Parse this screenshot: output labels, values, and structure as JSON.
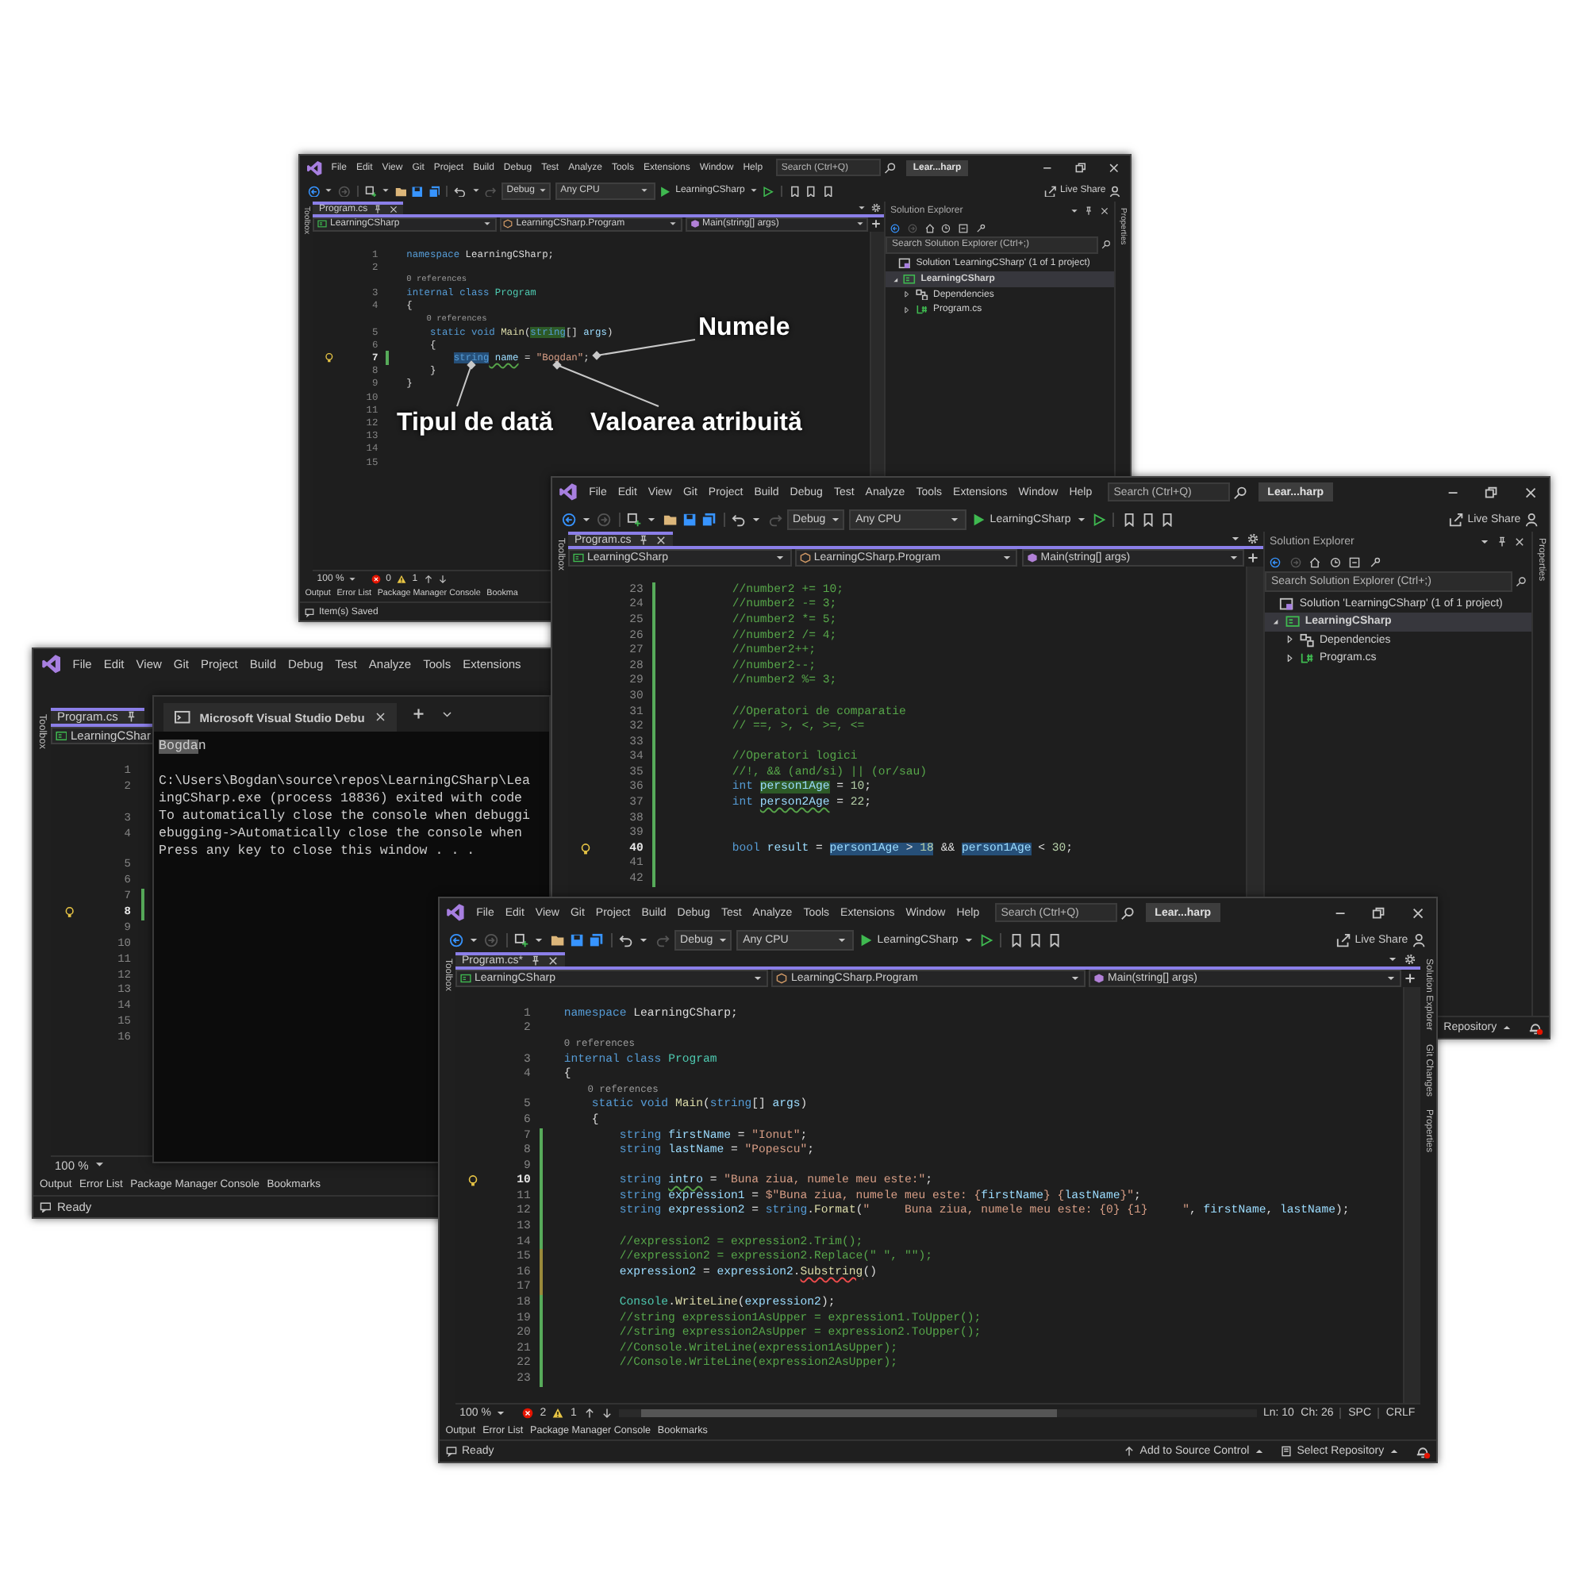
{
  "windows": [
    {
      "kind": "vs",
      "menu": [
        "File",
        "Edit",
        "View",
        "Git",
        "Project",
        "Build",
        "Debug",
        "Test",
        "Analyze",
        "Tools",
        "Extensions",
        "Window",
        "Help"
      ],
      "search": {
        "placeholder": "Search (Ctrl+Q)"
      },
      "title": "Lear...harp",
      "toolbar": {
        "configuration": "Debug",
        "platform": "Any CPU",
        "startup": "LearningCSharp",
        "live_share": "Live Share"
      },
      "left_strip": "Toolbox",
      "right_strip": [
        "Properties"
      ],
      "tab": {
        "label": "Program.cs"
      },
      "nav": [
        "LearningCSharp",
        "LearningCSharp.Program",
        "Main(string[] args)"
      ],
      "editor": {
        "lines": [
          {
            "kind": "code",
            "n": "1",
            "tokens": [
              {
                "t": "namespace",
                "kind": "keyword"
              },
              {
                "t": " LearningCSharp;",
                "kind": "plain"
              }
            ]
          },
          {
            "kind": "code",
            "n": "2"
          },
          {
            "kind": "lens",
            "text": "0 references"
          },
          {
            "kind": "code",
            "n": "3",
            "tokens": [
              {
                "t": "internal class ",
                "kind": "keyword"
              },
              {
                "t": "Program",
                "kind": "type"
              }
            ]
          },
          {
            "kind": "code",
            "n": "4",
            "tokens": [
              {
                "t": "{",
                "kind": "plain"
              }
            ]
          },
          {
            "kind": "lens",
            "text": "    0 references"
          },
          {
            "kind": "code",
            "n": "5",
            "tokens": [
              {
                "t": "    static void ",
                "kind": "keyword"
              },
              {
                "t": "Main",
                "kind": "method"
              },
              {
                "t": "(",
                "kind": "plain"
              },
              {
                "t": "string",
                "kind": "keyword",
                "highlighted": true
              },
              {
                "t": "[] ",
                "kind": "plain"
              },
              {
                "t": "args",
                "kind": "variable"
              },
              {
                "t": ")",
                "kind": "plain"
              }
            ]
          },
          {
            "kind": "code",
            "n": "6",
            "tokens": [
              {
                "t": "    {",
                "kind": "plain"
              }
            ]
          },
          {
            "kind": "code",
            "n": "7",
            "current": true,
            "color": "#57ab5a",
            "tokens": [
              {
                "t": "        string",
                "kind": "keyword",
                "selected": true
              },
              {
                "t": " name",
                "kind": "variable",
                "warning": true
              },
              {
                "t": " = ",
                "kind": "plain"
              },
              {
                "t": "\"Bogdan\"",
                "kind": "string"
              },
              {
                "t": ";",
                "kind": "plain"
              }
            ]
          },
          {
            "kind": "code",
            "n": "8",
            "tokens": [
              {
                "t": "    }",
                "kind": "plain"
              }
            ]
          },
          {
            "kind": "code",
            "n": "9",
            "tokens": [
              {
                "t": "}",
                "kind": "plain"
              }
            ]
          },
          {
            "kind": "code",
            "n": "10"
          },
          {
            "kind": "code",
            "n": "11"
          },
          {
            "kind": "code",
            "n": "12"
          },
          {
            "kind": "code",
            "n": "13"
          },
          {
            "kind": "code",
            "n": "14"
          },
          {
            "kind": "code",
            "n": "15"
          }
        ]
      },
      "editor_status": {
        "zoom": "100 %",
        "errors": "0",
        "warnings": "1"
      },
      "solution_explorer": {
        "title": "Solution Explorer",
        "search": {
          "placeholder": "Search Solution Explorer (Ctrl+;)"
        },
        "solution": "Solution 'LearningCSharp' (1 of 1 project)",
        "items": [
          {
            "label": "LearningCSharp",
            "kind": "project",
            "expanded": true,
            "selected": true,
            "children": [
              {
                "label": "Dependencies",
                "kind": "deps",
                "expanded": false,
                "selected": false
              },
              {
                "label": "Program.cs",
                "kind": "file",
                "expanded": false,
                "selected": false
              }
            ]
          }
        ]
      },
      "bottom_tabs": [
        "Output",
        "Error List",
        "Package Manager Console",
        "Bookma"
      ],
      "status": {
        "text": "Item(s) Saved"
      }
    },
    {
      "kind": "vs",
      "menu": [
        "File",
        "Edit",
        "View",
        "Git",
        "Project",
        "Build",
        "Debug",
        "Test",
        "Analyze",
        "Tools",
        "Extensions"
      ],
      "left_strip": "Toolbox",
      "tab": {
        "label": "Program.cs"
      },
      "nav": [
        "LearningCShar"
      ],
      "editor": {
        "lines": [
          {
            "kind": "code",
            "n": "1"
          },
          {
            "kind": "code",
            "n": "2"
          },
          {
            "kind": "lens"
          },
          {
            "kind": "code",
            "n": "3"
          },
          {
            "kind": "code",
            "n": "4"
          },
          {
            "kind": "lens"
          },
          {
            "kind": "code",
            "n": "5"
          },
          {
            "kind": "code",
            "n": "6"
          },
          {
            "kind": "code",
            "n": "7",
            "color": "#57ab5a"
          },
          {
            "kind": "code",
            "n": "8",
            "current": true,
            "color": "#57ab5a"
          },
          {
            "kind": "code",
            "n": "9"
          },
          {
            "kind": "code",
            "n": "10"
          },
          {
            "kind": "code",
            "n": "11"
          },
          {
            "kind": "code",
            "n": "12"
          },
          {
            "kind": "code",
            "n": "13"
          },
          {
            "kind": "code",
            "n": "14"
          },
          {
            "kind": "code",
            "n": "15"
          },
          {
            "kind": "code",
            "n": "16"
          }
        ]
      },
      "editor_status": {
        "zoom": "100 %"
      },
      "bottom_tabs": [
        "Output",
        "Error List",
        "Package Manager Console",
        "Bookmarks"
      ],
      "status": {
        "text": "Ready"
      },
      "console": {
        "title": "Microsoft Visual Studio Debu",
        "echo": [
          {
            "t": "Bogda",
            "selected": true
          },
          {
            "t": "n",
            "selected": false
          }
        ],
        "lines": [
          "C:\\Users\\Bogdan\\source\\repos\\LearningCSharp\\Lea",
          "ingCSharp.exe (process 18836) exited with code",
          "To automatically close the console when debuggi",
          "ebugging->Automatically close the console when",
          "Press any key to close this window . . ."
        ]
      }
    },
    {
      "kind": "vs",
      "menu": [
        "File",
        "Edit",
        "View",
        "Git",
        "Project",
        "Build",
        "Debug",
        "Test",
        "Analyze",
        "Tools",
        "Extensions",
        "Window",
        "Help"
      ],
      "search": {
        "placeholder": "Search (Ctrl+Q)"
      },
      "title": "Lear...harp",
      "toolbar": {
        "configuration": "Debug",
        "platform": "Any CPU",
        "startup": "LearningCSharp",
        "live_share": "Live Share"
      },
      "left_strip": "Toolbox",
      "right_strip": [
        "Properties"
      ],
      "tab": {
        "label": "Program.cs"
      },
      "nav": [
        "LearningCSharp",
        "LearningCSharp.Program",
        "Main(string[] args)"
      ],
      "editor": {
        "lines": [
          {
            "kind": "code",
            "n": "23",
            "color": "#57ab5a",
            "tokens": [
              {
                "t": "        //number2 += 10;",
                "kind": "comment"
              }
            ]
          },
          {
            "kind": "code",
            "n": "24",
            "color": "#57ab5a",
            "tokens": [
              {
                "t": "        //number2 -= 3;",
                "kind": "comment"
              }
            ]
          },
          {
            "kind": "code",
            "n": "25",
            "color": "#57ab5a",
            "tokens": [
              {
                "t": "        //number2 *= 5;",
                "kind": "comment"
              }
            ]
          },
          {
            "kind": "code",
            "n": "26",
            "color": "#57ab5a",
            "tokens": [
              {
                "t": "        //number2 /= 4;",
                "kind": "comment"
              }
            ]
          },
          {
            "kind": "code",
            "n": "27",
            "color": "#57ab5a",
            "tokens": [
              {
                "t": "        //number2++;",
                "kind": "comment"
              }
            ]
          },
          {
            "kind": "code",
            "n": "28",
            "color": "#57ab5a",
            "tokens": [
              {
                "t": "        //number2--;",
                "kind": "comment"
              }
            ]
          },
          {
            "kind": "code",
            "n": "29",
            "color": "#57ab5a",
            "tokens": [
              {
                "t": "        //number2 %= 3;",
                "kind": "comment"
              }
            ]
          },
          {
            "kind": "code",
            "n": "30",
            "color": "#57ab5a"
          },
          {
            "kind": "code",
            "n": "31",
            "color": "#57ab5a",
            "tokens": [
              {
                "t": "        //Operatori de comparatie",
                "kind": "comment"
              }
            ]
          },
          {
            "kind": "code",
            "n": "32",
            "color": "#57ab5a",
            "tokens": [
              {
                "t": "        // ==, >, <, >=, <=",
                "kind": "comment"
              }
            ]
          },
          {
            "kind": "code",
            "n": "33",
            "color": "#57ab5a"
          },
          {
            "kind": "code",
            "n": "34",
            "color": "#57ab5a",
            "tokens": [
              {
                "t": "        //Operatori logici",
                "kind": "comment"
              }
            ]
          },
          {
            "kind": "code",
            "n": "35",
            "color": "#57ab5a",
            "tokens": [
              {
                "t": "        //!, && (and/si) || (or/sau)",
                "kind": "comment"
              }
            ]
          },
          {
            "kind": "code",
            "n": "36",
            "color": "#57ab5a",
            "tokens": [
              {
                "t": "        int ",
                "kind": "keyword"
              },
              {
                "t": "person1Age",
                "kind": "variable",
                "highlighted": true
              },
              {
                "t": " = ",
                "kind": "plain"
              },
              {
                "t": "10",
                "kind": "number"
              },
              {
                "t": ";",
                "kind": "plain"
              }
            ]
          },
          {
            "kind": "code",
            "n": "37",
            "color": "#57ab5a",
            "tokens": [
              {
                "t": "        int ",
                "kind": "keyword"
              },
              {
                "t": "person2Age",
                "kind": "variable",
                "warning": true
              },
              {
                "t": " = ",
                "kind": "plain"
              },
              {
                "t": "22",
                "kind": "number"
              },
              {
                "t": ";",
                "kind": "plain"
              }
            ]
          },
          {
            "kind": "code",
            "n": "38",
            "color": "#57ab5a"
          },
          {
            "kind": "code",
            "n": "39",
            "color": "#57ab5a"
          },
          {
            "kind": "code",
            "n": "40",
            "current": true,
            "color": "#57ab5a",
            "tokens": [
              {
                "t": "        bool ",
                "kind": "keyword"
              },
              {
                "t": "result",
                "kind": "variable"
              },
              {
                "t": " = ",
                "kind": "plain"
              },
              {
                "t": "person1Age",
                "kind": "variable",
                "selected": true
              },
              {
                "t": " > ",
                "kind": "plain",
                "selected": true
              },
              {
                "t": "18",
                "kind": "number",
                "selected": true
              },
              {
                "t": " && ",
                "kind": "plain"
              },
              {
                "t": "person1Age",
                "kind": "variable",
                "selected": true
              },
              {
                "t": " < ",
                "kind": "plain"
              },
              {
                "t": "30",
                "kind": "number"
              },
              {
                "t": ";",
                "kind": "plain"
              }
            ]
          },
          {
            "kind": "code",
            "n": "41",
            "color": "#57ab5a"
          },
          {
            "kind": "code",
            "n": "42",
            "color": "#57ab5a"
          }
        ]
      },
      "solution_explorer": {
        "title": "Solution Explorer",
        "search": {
          "placeholder": "Search Solution Explorer (Ctrl+;)"
        },
        "solution": "Solution 'LearningCSharp' (1 of 1 project)",
        "items": [
          {
            "label": "LearningCSharp",
            "kind": "project",
            "expanded": true,
            "selected": true,
            "children": [
              {
                "label": "Dependencies",
                "kind": "deps",
                "expanded": false,
                "selected": false
              },
              {
                "label": "Program.cs",
                "kind": "file",
                "expanded": false,
                "selected": false
              }
            ]
          }
        ]
      },
      "status": {
        "right_items": [
          {
            "label": "Repository",
            "kind": "cut"
          }
        ]
      }
    },
    {
      "kind": "vs",
      "menu": [
        "File",
        "Edit",
        "View",
        "Git",
        "Project",
        "Build",
        "Debug",
        "Test",
        "Analyze",
        "Tools",
        "Extensions",
        "Window",
        "Help"
      ],
      "search": {
        "placeholder": "Search (Ctrl+Q)"
      },
      "title": "Lear...harp",
      "toolbar": {
        "configuration": "Debug",
        "platform": "Any CPU",
        "startup": "LearningCSharp",
        "live_share": "Live Share"
      },
      "left_strip": "Toolbox",
      "right_strip": [
        "Solution Explorer",
        "Git Changes",
        "Properties"
      ],
      "tab": {
        "label": "Program.cs*"
      },
      "nav": [
        "LearningCSharp",
        "LearningCSharp.Program",
        "Main(string[] args)"
      ],
      "editor": {
        "lines": [
          {
            "kind": "code",
            "n": "1",
            "tokens": [
              {
                "t": "namespace",
                "kind": "keyword"
              },
              {
                "t": " LearningCSharp;",
                "kind": "plain"
              }
            ]
          },
          {
            "kind": "code",
            "n": "2"
          },
          {
            "kind": "lens",
            "text": "0 references"
          },
          {
            "kind": "code",
            "n": "3",
            "tokens": [
              {
                "t": "internal class ",
                "kind": "keyword"
              },
              {
                "t": "Program",
                "kind": "type"
              }
            ]
          },
          {
            "kind": "code",
            "n": "4",
            "tokens": [
              {
                "t": "{",
                "kind": "plain"
              }
            ]
          },
          {
            "kind": "lens",
            "text": "    0 references"
          },
          {
            "kind": "code",
            "n": "5",
            "tokens": [
              {
                "t": "    static void ",
                "kind": "keyword"
              },
              {
                "t": "Main",
                "kind": "method"
              },
              {
                "t": "(",
                "kind": "plain"
              },
              {
                "t": "string",
                "kind": "keyword"
              },
              {
                "t": "[] ",
                "kind": "plain"
              },
              {
                "t": "args",
                "kind": "variable"
              },
              {
                "t": ")",
                "kind": "plain"
              }
            ]
          },
          {
            "kind": "code",
            "n": "6",
            "tokens": [
              {
                "t": "    {",
                "kind": "plain"
              }
            ]
          },
          {
            "kind": "code",
            "n": "7",
            "color": "#57ab5a",
            "tokens": [
              {
                "t": "        string ",
                "kind": "keyword"
              },
              {
                "t": "firstName",
                "kind": "variable"
              },
              {
                "t": " = ",
                "kind": "plain"
              },
              {
                "t": "\"Ionut\"",
                "kind": "string"
              },
              {
                "t": ";",
                "kind": "plain"
              }
            ]
          },
          {
            "kind": "code",
            "n": "8",
            "color": "#57ab5a",
            "tokens": [
              {
                "t": "        string ",
                "kind": "keyword"
              },
              {
                "t": "lastName",
                "kind": "variable"
              },
              {
                "t": " = ",
                "kind": "plain"
              },
              {
                "t": "\"Popescu\"",
                "kind": "string"
              },
              {
                "t": ";",
                "kind": "plain"
              }
            ]
          },
          {
            "kind": "code",
            "n": "9",
            "color": "#57ab5a"
          },
          {
            "kind": "code",
            "n": "10",
            "current": true,
            "color": "#57ab5a",
            "tokens": [
              {
                "t": "        string ",
                "kind": "keyword"
              },
              {
                "t": "intro",
                "kind": "variable",
                "warning": true
              },
              {
                "t": " = ",
                "kind": "plain"
              },
              {
                "t": "\"Buna ziua, numele meu este:\"",
                "kind": "string"
              },
              {
                "t": ";",
                "kind": "plain"
              }
            ]
          },
          {
            "kind": "code",
            "n": "11",
            "color": "#57ab5a",
            "tokens": [
              {
                "t": "        string ",
                "kind": "keyword"
              },
              {
                "t": "expression1",
                "kind": "variable"
              },
              {
                "t": " = ",
                "kind": "plain"
              },
              {
                "t": "$\"Buna ziua, numele meu este: {",
                "kind": "string"
              },
              {
                "t": "firstName",
                "kind": "variable"
              },
              {
                "t": "} {",
                "kind": "string"
              },
              {
                "t": "lastName",
                "kind": "variable"
              },
              {
                "t": "}\"",
                "kind": "string"
              },
              {
                "t": ";",
                "kind": "plain"
              }
            ]
          },
          {
            "kind": "code",
            "n": "12",
            "color": "#57ab5a",
            "tokens": [
              {
                "t": "        string ",
                "kind": "keyword"
              },
              {
                "t": "expression2",
                "kind": "variable"
              },
              {
                "t": " = ",
                "kind": "plain"
              },
              {
                "t": "string",
                "kind": "keyword"
              },
              {
                "t": ".",
                "kind": "plain"
              },
              {
                "t": "Format",
                "kind": "method"
              },
              {
                "t": "(",
                "kind": "plain"
              },
              {
                "t": "\"     Buna ziua, numele meu este: {0} {1}     \"",
                "kind": "string"
              },
              {
                "t": ", ",
                "kind": "plain"
              },
              {
                "t": "firstName",
                "kind": "variable"
              },
              {
                "t": ", ",
                "kind": "plain"
              },
              {
                "t": "lastName",
                "kind": "variable"
              },
              {
                "t": ");",
                "kind": "plain"
              }
            ]
          },
          {
            "kind": "code",
            "n": "13",
            "color": "#57ab5a"
          },
          {
            "kind": "code",
            "n": "14",
            "color": "#57ab5a",
            "tokens": [
              {
                "t": "        //expression2 = expression2.Trim();",
                "kind": "comment"
              }
            ]
          },
          {
            "kind": "code",
            "n": "15",
            "color": "#9a8a3a",
            "tokens": [
              {
                "t": "        //expression2 = expression2.Replace(\" \", \"\");",
                "kind": "comment"
              }
            ]
          },
          {
            "kind": "code",
            "n": "16",
            "color": "#9a8a3a",
            "tokens": [
              {
                "t": "        expression2",
                "kind": "variable"
              },
              {
                "t": " = ",
                "kind": "plain"
              },
              {
                "t": "expression2",
                "kind": "variable"
              },
              {
                "t": ".",
                "kind": "plain"
              },
              {
                "t": "Substring",
                "kind": "method",
                "error": true
              },
              {
                "t": "()",
                "kind": "plain"
              }
            ]
          },
          {
            "kind": "code",
            "n": "17",
            "color": "#9a8a3a"
          },
          {
            "kind": "code",
            "n": "18",
            "color": "#57ab5a",
            "tokens": [
              {
                "t": "        Console",
                "kind": "type"
              },
              {
                "t": ".",
                "kind": "plain"
              },
              {
                "t": "WriteLine",
                "kind": "method"
              },
              {
                "t": "(",
                "kind": "plain"
              },
              {
                "t": "expression2",
                "kind": "variable"
              },
              {
                "t": ");",
                "kind": "plain"
              }
            ]
          },
          {
            "kind": "code",
            "n": "19",
            "color": "#57ab5a",
            "tokens": [
              {
                "t": "        //string expression1AsUpper = expression1.ToUpper();",
                "kind": "comment"
              }
            ]
          },
          {
            "kind": "code",
            "n": "20",
            "color": "#57ab5a",
            "tokens": [
              {
                "t": "        //string expression2AsUpper = expression2.ToUpper();",
                "kind": "comment"
              }
            ]
          },
          {
            "kind": "code",
            "n": "21",
            "color": "#57ab5a",
            "tokens": [
              {
                "t": "        //Console.WriteLine(expression1AsUpper);",
                "kind": "comment"
              }
            ]
          },
          {
            "kind": "code",
            "n": "22",
            "color": "#57ab5a",
            "tokens": [
              {
                "t": "        //Console.WriteLine(expression2AsUpper);",
                "kind": "comment"
              }
            ]
          },
          {
            "kind": "code",
            "n": "23",
            "color": "#57ab5a"
          }
        ]
      },
      "editor_status": {
        "zoom": "100 %",
        "errors": "2",
        "warnings": "1",
        "line": "Ln: 10",
        "column": "Ch: 26",
        "indent": "SPC",
        "line_ending": "CRLF"
      },
      "bottom_tabs": [
        "Output",
        "Error List",
        "Package Manager Console",
        "Bookmarks"
      ],
      "status": {
        "text": "Ready",
        "right_items": [
          {
            "label": "Add to Source Control",
            "kind": "source"
          },
          {
            "label": "Select Repository",
            "kind": "repo"
          }
        ]
      }
    }
  ],
  "annotations": [
    {
      "text": "Numele"
    },
    {
      "text": "Tipul de dată"
    },
    {
      "text": "Valoarea atribuită"
    }
  ]
}
